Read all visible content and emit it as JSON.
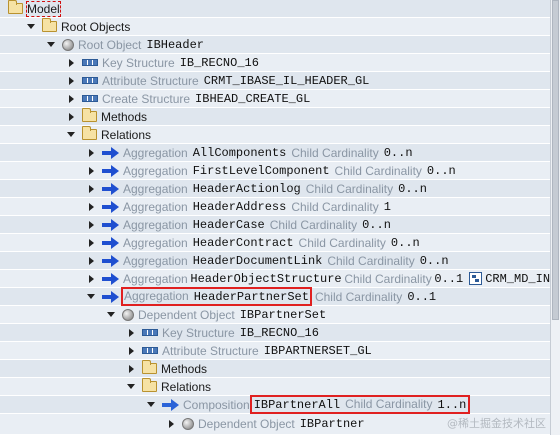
{
  "rows": [
    {
      "kind": "model",
      "label": "Model"
    },
    {
      "kind": "root",
      "label": "Root Objects"
    },
    {
      "kind": "rootobj",
      "type": "Root Object",
      "name": "IBHeader"
    },
    {
      "kind": "struct",
      "type": "Key Structure",
      "name": "IB_RECNO_16"
    },
    {
      "kind": "struct",
      "type": "Attribute Structure",
      "name": "CRMT_IBASE_IL_HEADER_GL"
    },
    {
      "kind": "struct",
      "type": "Create Structure",
      "name": "IBHEAD_CREATE_GL"
    },
    {
      "kind": "folder",
      "label": "Methods"
    },
    {
      "kind": "folder",
      "label": "Relations"
    },
    {
      "kind": "agg",
      "type": "Aggregation",
      "name": "AllComponents",
      "card_label": "Child Cardinality",
      "card": "0..n"
    },
    {
      "kind": "agg",
      "type": "Aggregation",
      "name": "FirstLevelComponent",
      "card_label": "Child Cardinality",
      "card": "0..n"
    },
    {
      "kind": "agg",
      "type": "Aggregation",
      "name": "HeaderActionlog",
      "card_label": "Child Cardinality",
      "card": "0..n"
    },
    {
      "kind": "agg",
      "type": "Aggregation",
      "name": "HeaderAddress",
      "card_label": "Child Cardinality",
      "card": "1"
    },
    {
      "kind": "agg",
      "type": "Aggregation",
      "name": "HeaderCase",
      "card_label": "Child Cardinality",
      "card": "0..n"
    },
    {
      "kind": "agg",
      "type": "Aggregation",
      "name": "HeaderContract",
      "card_label": "Child Cardinality",
      "card": "0..n"
    },
    {
      "kind": "agg",
      "type": "Aggregation",
      "name": "HeaderDocumentLink",
      "card_label": "Child Cardinality",
      "card": "0..n"
    },
    {
      "kind": "agg",
      "type": "Aggregation",
      "name": "HeaderObjectStructure",
      "card_label": "Child Cardinality",
      "card": "0..1",
      "extra": "CRM_MD_IN"
    },
    {
      "kind": "agg",
      "type": "Aggregation",
      "name": "HeaderPartnerSet",
      "card_label": "Child Cardinality",
      "card": "0..1"
    },
    {
      "kind": "dep",
      "type": "Dependent Object",
      "name": "IBPartnerSet"
    },
    {
      "kind": "struct2",
      "type": "Key Structure",
      "name": "IB_RECNO_16"
    },
    {
      "kind": "struct2",
      "type": "Attribute Structure",
      "name": "IBPARTNERSET_GL"
    },
    {
      "kind": "folder2",
      "label": "Methods"
    },
    {
      "kind": "folder2",
      "label": "Relations"
    },
    {
      "kind": "comp",
      "type": "Composition",
      "name": "IBPartnerAll",
      "card_label": "Child Cardinality",
      "card": "1..n"
    },
    {
      "kind": "dep2",
      "type": "Dependent Object",
      "name": "IBPartner"
    }
  ],
  "watermark": "@稀土掘金技术社区",
  "icons": {
    "model": "folder-open-icon",
    "folder": "folder-icon",
    "object": "sphere-icon",
    "structure": "structure-icon",
    "relation": "arrow-right-icon",
    "attached": "structure-link-icon"
  }
}
